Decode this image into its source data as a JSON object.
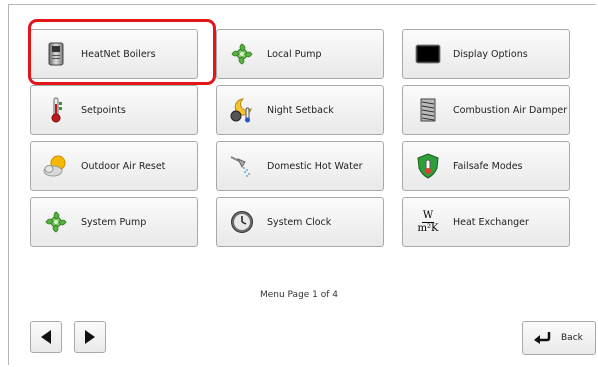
{
  "menu": {
    "items": [
      {
        "label": "HeatNet Boilers",
        "icon": "boiler-icon"
      },
      {
        "label": "Local Pump",
        "icon": "pump-icon"
      },
      {
        "label": "Display Options",
        "icon": "display-icon"
      },
      {
        "label": "Setpoints",
        "icon": "thermometer-icon"
      },
      {
        "label": "Night Setback",
        "icon": "night-setback-icon"
      },
      {
        "label": "Combustion Air Damper",
        "icon": "damper-icon"
      },
      {
        "label": "Outdoor Air Reset",
        "icon": "sun-cloud-icon"
      },
      {
        "label": "Domestic Hot Water",
        "icon": "shower-icon"
      },
      {
        "label": "Failsafe Modes",
        "icon": "shield-icon"
      },
      {
        "label": "System Pump",
        "icon": "pump-icon"
      },
      {
        "label": "System Clock",
        "icon": "clock-icon"
      },
      {
        "label": "Heat Exchanger",
        "icon": "w-per-m2k-icon"
      }
    ],
    "selected": "HeatNet Boilers"
  },
  "pager": {
    "label": "Menu Page 1 of 4"
  },
  "nav": {
    "back_label": "Back"
  },
  "units": {
    "numerator": "W",
    "denominator": "m²K"
  },
  "colors": {
    "highlight": "#e0161b",
    "pump_green": "#4caf3a"
  }
}
